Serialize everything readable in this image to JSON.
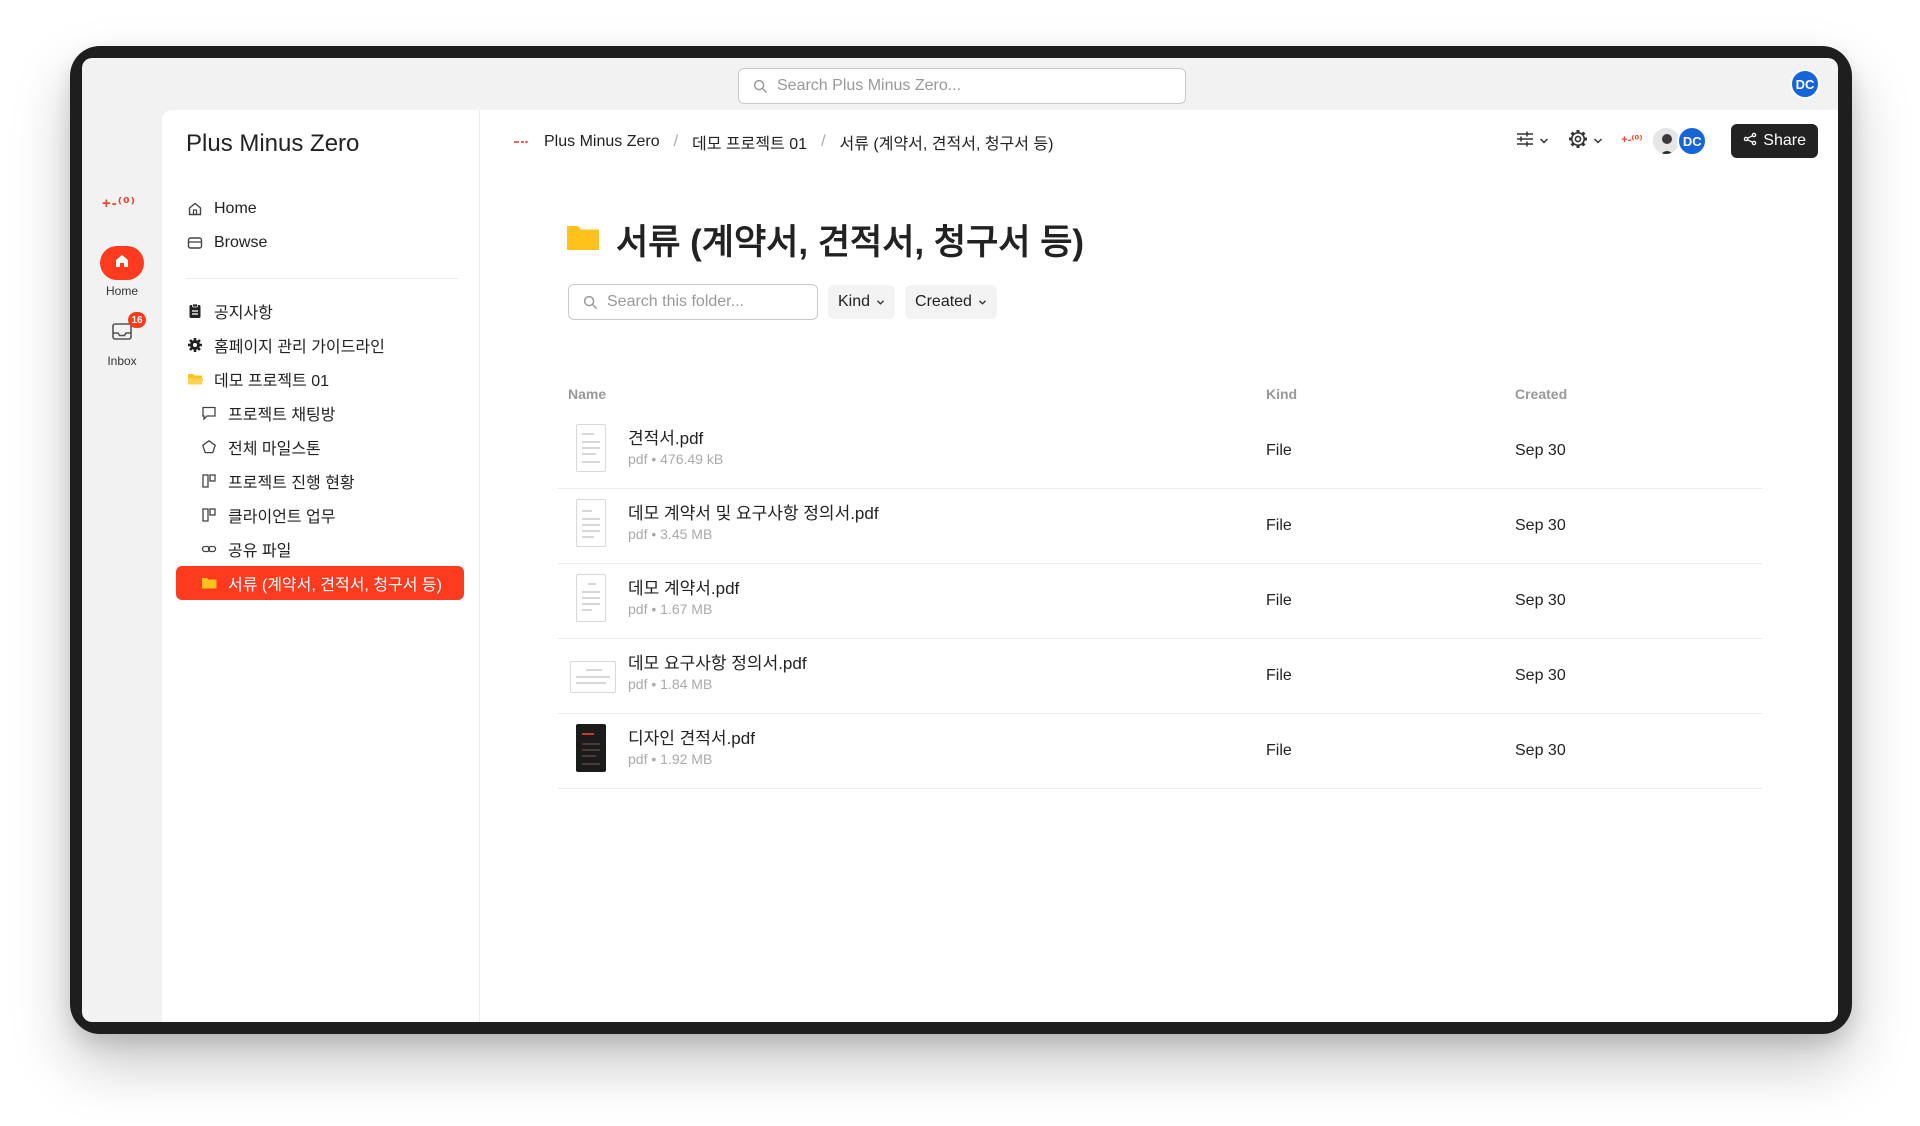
{
  "global_search": {
    "placeholder": "Search Plus Minus Zero..."
  },
  "user": {
    "initials": "DC"
  },
  "rail": {
    "logo": "+-⁽⁰⁾",
    "home_label": "Home",
    "inbox_label": "Inbox",
    "inbox_badge": "16"
  },
  "sidebar": {
    "workspace_title": "Plus Minus Zero",
    "top_items": [
      {
        "label": "Home",
        "icon": "home-icon"
      },
      {
        "label": "Browse",
        "icon": "browse-icon"
      }
    ],
    "items": [
      {
        "label": "공지사항",
        "icon": "clipboard-icon"
      },
      {
        "label": "홈페이지 관리 가이드라인",
        "icon": "gear-icon"
      },
      {
        "label": "데모 프로젝트 01",
        "icon": "folder-open-icon"
      },
      {
        "label": "프로젝트 채팅방",
        "icon": "chat-icon"
      },
      {
        "label": "전체 마일스톤",
        "icon": "pentagon-icon"
      },
      {
        "label": "프로젝트 진행 현황",
        "icon": "board-icon"
      },
      {
        "label": "클라이언트 업무",
        "icon": "board-icon"
      },
      {
        "label": "공유 파일",
        "icon": "link-icon"
      },
      {
        "label": "서류 (계약서, 견적서, 청구서 등)",
        "icon": "folder-icon"
      }
    ]
  },
  "breadcrumb": [
    "Plus Minus Zero",
    "데모 프로젝트 01",
    "서류 (계약서, 견적서, 청구서 등)"
  ],
  "breadcrumb_separator": "/",
  "toolbar": {
    "share_label": "Share",
    "mini_logo": "+-⁽⁰⁾"
  },
  "page": {
    "title": "서류 (계약서, 견적서, 청구서 등)",
    "folder_search_placeholder": "Search this folder...",
    "filter_kind": "Kind",
    "filter_created": "Created"
  },
  "table": {
    "columns": {
      "name": "Name",
      "kind": "Kind",
      "created": "Created"
    },
    "rows": [
      {
        "name": "견적서.pdf",
        "meta": "pdf • 476.49 kB",
        "kind": "File",
        "created": "Sep 30"
      },
      {
        "name": "데모 계약서 및 요구사항 정의서.pdf",
        "meta": "pdf • 3.45 MB",
        "kind": "File",
        "created": "Sep 30"
      },
      {
        "name": "데모 계약서.pdf",
        "meta": "pdf • 1.67 MB",
        "kind": "File",
        "created": "Sep 30"
      },
      {
        "name": "데모 요구사항 정의서.pdf",
        "meta": "pdf • 1.84 MB",
        "kind": "File",
        "created": "Sep 30"
      },
      {
        "name": "디자인 견적서.pdf",
        "meta": "pdf • 1.92 MB",
        "kind": "File",
        "created": "Sep 30"
      }
    ]
  },
  "colors": {
    "accent": "#ff3b1f",
    "folder": "#ffc21a",
    "avatar": "#1565d8",
    "share_button": "#222222"
  }
}
